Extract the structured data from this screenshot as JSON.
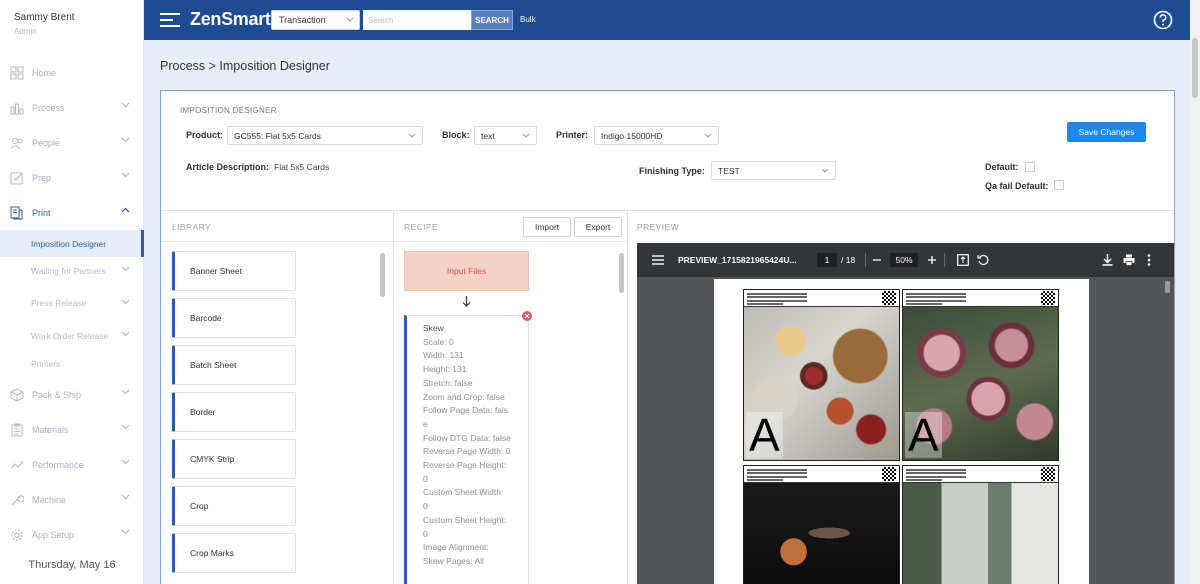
{
  "user": {
    "name": "Sammy Brent",
    "role": "Admin"
  },
  "nav": {
    "home": "Home",
    "process": "Process",
    "people": "People",
    "prep": "Prep",
    "print": "Print",
    "print_sub": {
      "imposition_designer": "Imposition Designer",
      "waiting_for_partners": "Waiting for Partners",
      "press_release": "Press Release",
      "work_order_release": "Work Order Release",
      "printers": "Printers"
    },
    "pack_ship": "Pack & Ship",
    "materials": "Materials",
    "performance": "Performance",
    "machine": "Machine",
    "app_setup": "App Setup"
  },
  "sidebar_date": "Thursday, May 16",
  "topbar": {
    "logo_bold": "ZenSmart",
    "search_type": "Transaction",
    "search_placeholder": "Search",
    "search_button": "SEARCH",
    "bulk": "Bulk"
  },
  "breadcrumb": "Process > Imposition Designer",
  "designer": {
    "title": "IMPOSITION DESIGNER",
    "product_label": "Product:",
    "product_value": "GC555: Flat 5x5 Cards",
    "block_label": "Block:",
    "block_value": "text",
    "printer_label": "Printer:",
    "printer_value": "Indigo 15000HD",
    "article_label": "Article Description:",
    "article_value": "Flat 5x5 Cards",
    "finishing_label": "Finishing Type:",
    "finishing_value": "TEST",
    "default_label": "Default:",
    "qa_fail_label": "Qa fail Default:",
    "save_button": "Save Changes"
  },
  "library": {
    "header": "LIBRARY",
    "items": [
      "Banner Sheet",
      "Barcode",
      "Batch Sheet",
      "Border",
      "CMYK Strip",
      "Crop",
      "Crop Marks"
    ]
  },
  "recipe": {
    "header": "RECIPE",
    "import": "Import",
    "export": "Export",
    "input_files": "Input Files",
    "skew_title": "Skew",
    "skew_rows": [
      "Scale: 0",
      "Width: 131",
      "Height: 131",
      "Stretch: false",
      "Zoom and Crop: false",
      "Follow Page Data: fals\ne",
      "Follow DTG Data: false",
      "Reverse Page Width: 0",
      "Reverse Page Height:\n0",
      "Custom Sheet Width:\n0",
      "Custom Sheet Height:\n0",
      "Image Alignment:",
      "Skew Pages: All"
    ]
  },
  "preview": {
    "header": "PREVIEW",
    "file_name": "PREVIEW_1715821965424U...",
    "page": "1",
    "total": "/ 18",
    "zoom": "50%",
    "tile_letter": "A"
  }
}
